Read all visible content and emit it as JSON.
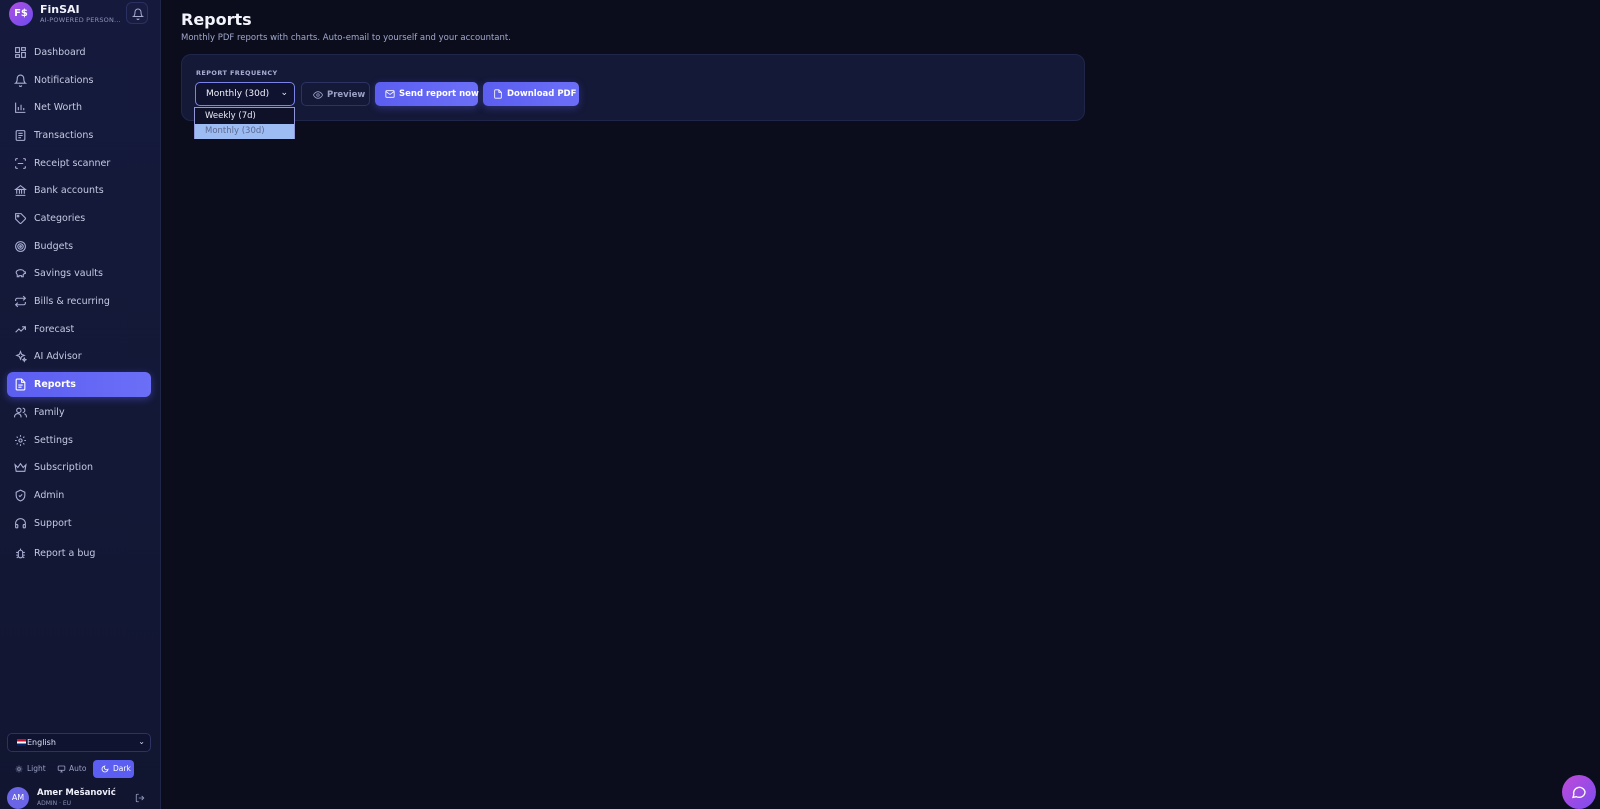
{
  "app": {
    "brand_initials": "F$",
    "brand_name": "FinSAI",
    "brand_tagline": "AI-POWERED PERSON..."
  },
  "sidebar": {
    "items": [
      {
        "label": "Dashboard",
        "icon": "grid-icon"
      },
      {
        "label": "Notifications",
        "icon": "bell-icon"
      },
      {
        "label": "Net Worth",
        "icon": "bar-chart-icon"
      },
      {
        "label": "Transactions",
        "icon": "receipt-icon"
      },
      {
        "label": "Receipt scanner",
        "icon": "scan-icon"
      },
      {
        "label": "Bank accounts",
        "icon": "bank-icon"
      },
      {
        "label": "Categories",
        "icon": "tag-icon"
      },
      {
        "label": "Budgets",
        "icon": "target-icon"
      },
      {
        "label": "Savings vaults",
        "icon": "piggy-bank-icon"
      },
      {
        "label": "Bills & recurring",
        "icon": "repeat-icon"
      },
      {
        "label": "Forecast",
        "icon": "trend-up-icon"
      },
      {
        "label": "AI Advisor",
        "icon": "sparkles-icon"
      },
      {
        "label": "Reports",
        "icon": "file-icon",
        "active": true
      },
      {
        "label": "Family",
        "icon": "users-icon"
      },
      {
        "label": "Settings",
        "icon": "gear-icon"
      },
      {
        "label": "Subscription",
        "icon": "crown-icon"
      },
      {
        "label": "Admin",
        "icon": "shield-icon"
      },
      {
        "label": "Support",
        "icon": "headset-icon"
      },
      {
        "label": "Report a bug",
        "icon": "bug-icon"
      }
    ],
    "language": "English",
    "theme": {
      "light": "Light",
      "auto": "Auto",
      "dark": "Dark",
      "selected": "Dark"
    },
    "user": {
      "initials": "AM",
      "name": "Amer Mešanović",
      "role": "ADMIN · EU"
    }
  },
  "page": {
    "title": "Reports",
    "subtitle": "Monthly PDF reports with charts. Auto-email to yourself and your accountant.",
    "frequency_label": "REPORT FREQUENCY",
    "frequency_value": "Monthly (30d)",
    "frequency_options": [
      "Weekly (7d)",
      "Monthly (30d)"
    ],
    "preview_label": "Preview",
    "send_label": "Send report now",
    "download_label": "Download PDF"
  },
  "colors": {
    "accent": "#5b5ef0",
    "background": "#0b0d1c",
    "sidebar": "#141a3b"
  }
}
